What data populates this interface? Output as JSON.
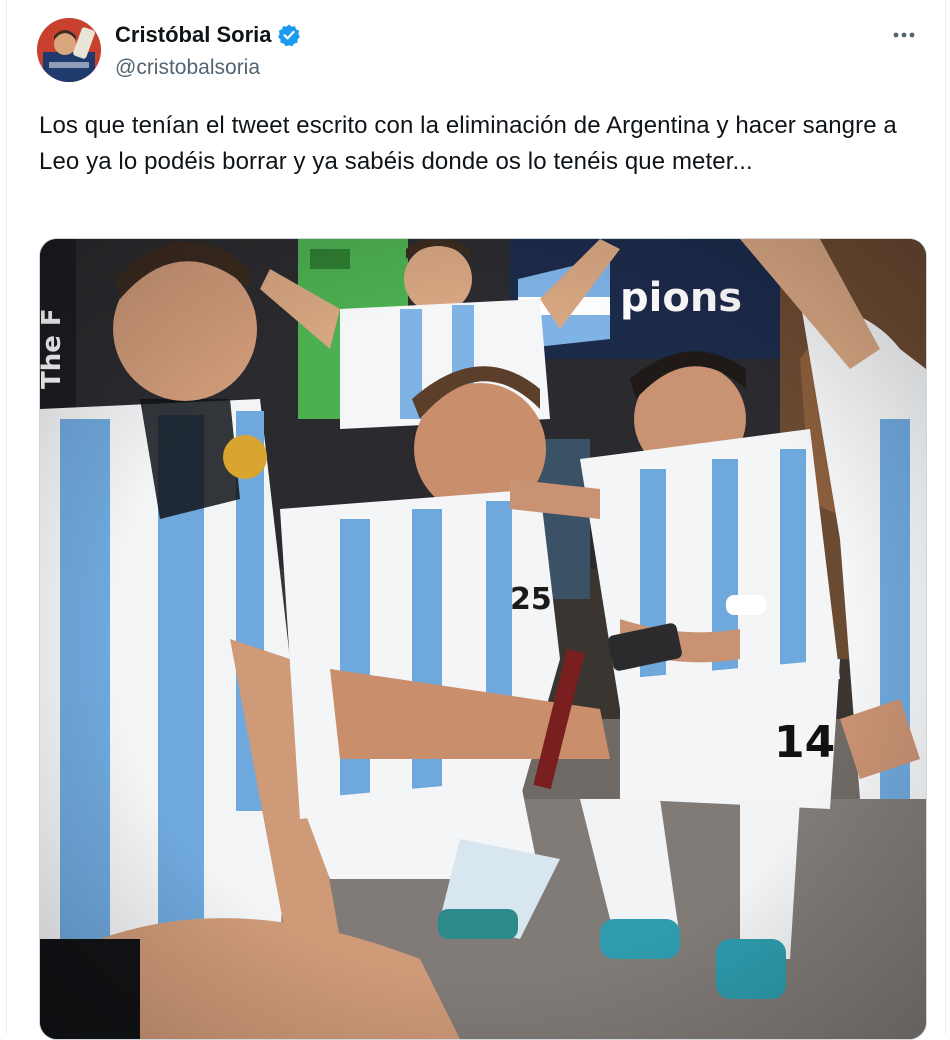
{
  "author": {
    "display_name": "Cristóbal Soria",
    "handle": "@cristobalsoria",
    "verified": true
  },
  "tweet": {
    "text": "Los que tenían el tweet escrito con la eliminación de Argentina y hacer sangre a Leo ya lo podéis borrar y ya sabéis donde os lo tenéis que meter..."
  },
  "media": {
    "banner_text": "pions",
    "side_text": "The F",
    "jersey_numbers": [
      "14",
      "25"
    ]
  },
  "icons": {
    "more": "more-options-icon",
    "verified": "verified-badge-icon"
  },
  "colors": {
    "verified_blue": "#1d9bf0",
    "text_primary": "#0f1419",
    "text_secondary": "#536471",
    "argentina_sky": "#6fa8dc"
  }
}
